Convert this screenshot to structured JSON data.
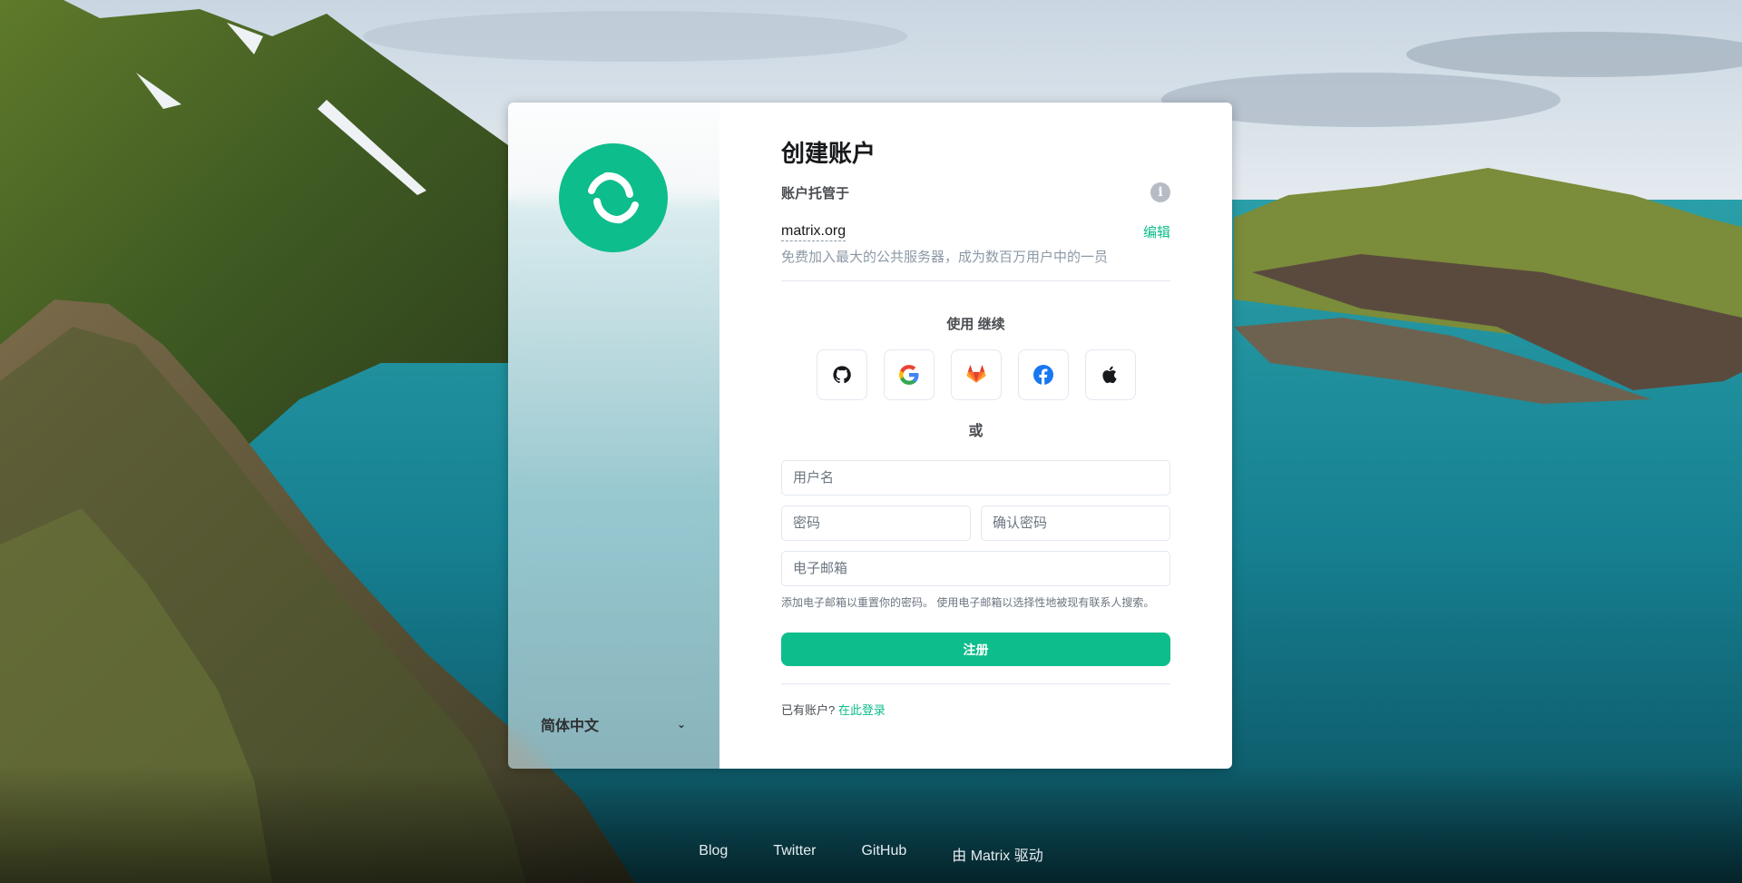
{
  "auth": {
    "title": "创建账户",
    "hosted_label": "账户托管于",
    "info_icon": "info-icon",
    "server_name": "matrix.org",
    "edit_label": "编辑",
    "server_description": "免费加入最大的公共服务器，成为数百万用户中的一员",
    "continue_label": "使用 继续",
    "sso_providers": [
      {
        "name": "GitHub",
        "icon": "github-icon"
      },
      {
        "name": "Google",
        "icon": "google-icon"
      },
      {
        "name": "GitLab",
        "icon": "gitlab-icon"
      },
      {
        "name": "Facebook",
        "icon": "facebook-icon"
      },
      {
        "name": "Apple",
        "icon": "apple-icon"
      }
    ],
    "or_label": "或",
    "username_placeholder": "用户名",
    "password_placeholder": "密码",
    "confirm_password_placeholder": "确认密码",
    "email_placeholder": "电子邮箱",
    "email_hint": "添加电子邮箱以重置你的密码。 使用电子邮箱以选择性地被现有联系人搜索。",
    "register_label": "注册",
    "have_account_text": "已有账户?",
    "sign_in_link": "在此登录"
  },
  "language": {
    "selected": "简体中文"
  },
  "footer": {
    "links": [
      "Blog",
      "Twitter",
      "GitHub",
      "由 Matrix 驱动"
    ]
  },
  "colors": {
    "accent": "#0dbd8b",
    "text_primary": "#17191c",
    "text_secondary": "#8d99a5"
  }
}
